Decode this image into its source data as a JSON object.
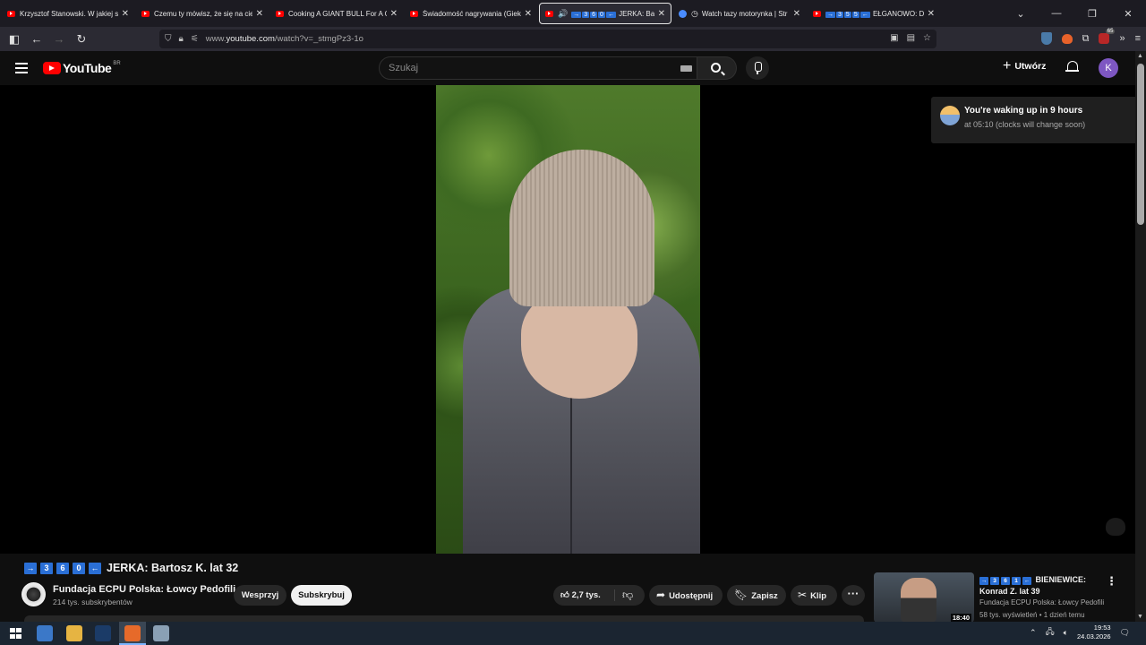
{
  "browser": {
    "tabs": [
      {
        "title": "Krzysztof Stanowski. W jakiej sp",
        "favicon": "youtube-icon",
        "active": false
      },
      {
        "title": "Czemu ty mówisz, że się na cie",
        "favicon": "youtube-icon",
        "active": false
      },
      {
        "title": "Cooking A GIANT BULL For A G",
        "favicon": "youtube-icon",
        "active": false
      },
      {
        "title": "Świadomość nagrywania (Giekł",
        "favicon": "youtube-icon",
        "active": false
      },
      {
        "title": "JERKA: Bar",
        "favicon": "youtube-icon",
        "active": true,
        "audio": true,
        "prefix": [
          "3",
          "6",
          "0"
        ]
      },
      {
        "title": "Watch tazy motorynka | Str",
        "favicon": "globe-icon",
        "active": false
      },
      {
        "title": "EŁGANOWO: D",
        "favicon": "youtube-icon",
        "active": false,
        "prefix": [
          "3",
          "5",
          "5"
        ]
      }
    ],
    "url_prefix": "www.",
    "url_domain": "youtube.com",
    "url_path": "/watch?v=_stmgPz3-1o",
    "extension_badge": "65"
  },
  "youtube": {
    "logo_text": "YouTube",
    "country_code": "BR",
    "search_placeholder": "Szukaj",
    "create_label": "Utwórz",
    "avatar_letter": "K"
  },
  "notification": {
    "title": "You're waking up in 9 hours",
    "subtitle": "at 05:10 (clocks will change soon)"
  },
  "video": {
    "title_badges": [
      "3",
      "6",
      "0"
    ],
    "title": "JERKA: Bartosz K. lat 32",
    "channel_name": "Fundacja ECPU Polska: Łowcy Pedofili",
    "subscribers": "214 tys. subskrybentów",
    "support_label": "Wesprzyj",
    "subscribe_label": "Subskrybuj",
    "likes": "2,7 tys.",
    "share_label": "Udostępnij",
    "save_label": "Zapisz",
    "clip_label": "Klip"
  },
  "recommended": {
    "badges": [
      "3",
      "6",
      "1"
    ],
    "title_line1": "BIENIEWICE:",
    "title_line2": "Konrad Z. lat 39",
    "channel": "Fundacja ECPU Polska: Łowcy Pedofili",
    "meta": "58 tys. wyświetleń • 1 dzień temu",
    "duration": "18:40"
  },
  "taskbar": {
    "time": "19:53",
    "date": "24.03.2026"
  },
  "colors": {
    "youtube_red": "#ff0000",
    "badge_blue": "#2a6fd6",
    "avatar_purple": "#7e57c2"
  }
}
